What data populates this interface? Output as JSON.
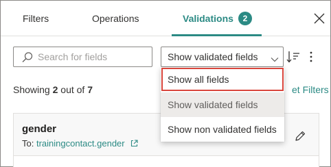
{
  "tabs": [
    {
      "label": "Filters",
      "active": false
    },
    {
      "label": "Operations",
      "active": false
    },
    {
      "label": "Validations",
      "active": true,
      "badge": "2"
    }
  ],
  "toolbar": {
    "search_placeholder": "Search for fields",
    "filter_select_value": "Show validated fields"
  },
  "summary": {
    "prefix": "Showing ",
    "shown": "2",
    "middle": " out of ",
    "total": "7",
    "reset_label": "et Filters"
  },
  "dropdown": {
    "options": [
      {
        "label": "Show all fields",
        "highlighted": true
      },
      {
        "label": "Show validated fields",
        "selected": true
      },
      {
        "label": "Show non validated fields"
      }
    ]
  },
  "card": {
    "name": "gender",
    "to_prefix": "To: ",
    "to_link": "trainingcontact.gender"
  },
  "colors": {
    "accent": "#2b8a84",
    "highlight_border": "#d9453c",
    "selected_bg": "#edebe9"
  },
  "icons": {
    "close": "close-icon",
    "search": "search-icon",
    "chevron": "chevron-down-icon",
    "sort": "sort-icon",
    "more": "more-vertical-icon",
    "external": "external-link-icon",
    "edit": "pencil-icon"
  }
}
